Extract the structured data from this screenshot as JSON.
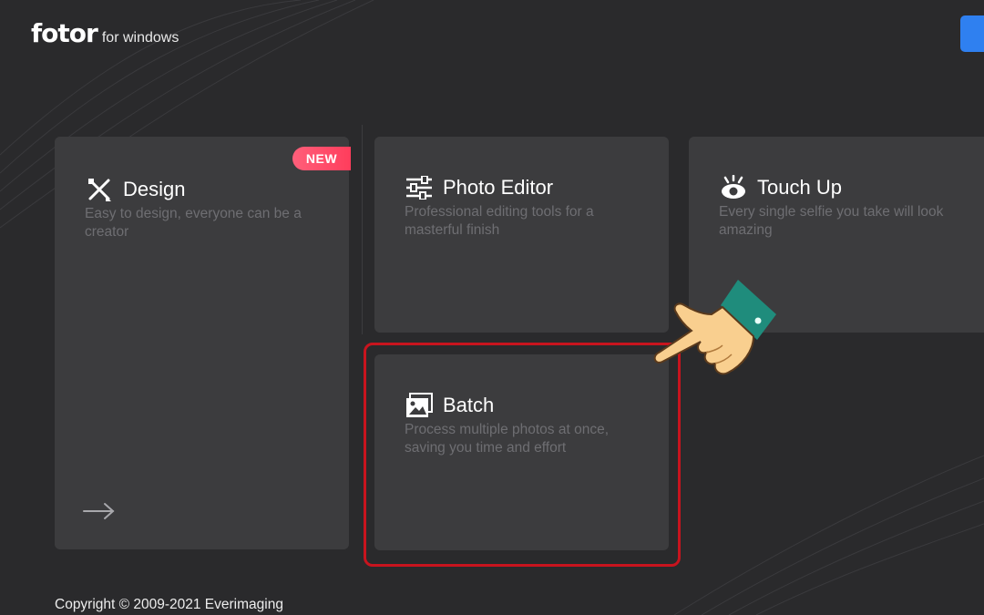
{
  "app": {
    "logo_text": "fotor",
    "logo_suffix": "for windows"
  },
  "cards": {
    "design": {
      "title": "Design",
      "description": "Easy to design, everyone can be a creator",
      "badge": "NEW",
      "icon": "design-pencil-ruler-icon"
    },
    "photo_editor": {
      "title": "Photo Editor",
      "description": "Professional editing tools for a masterful finish",
      "icon": "sliders-icon"
    },
    "touch_up": {
      "title": "Touch Up",
      "description": "Every single selfie you take will look amazing",
      "icon": "eye-icon"
    },
    "batch": {
      "title": "Batch",
      "description": "Process multiple photos at once, saving you time and effort",
      "icon": "images-stack-icon"
    }
  },
  "footer": {
    "copyright": "Copyright © 2009-2021 Everimaging"
  },
  "colors": {
    "background": "#2a2a2c",
    "card": "#3c3c3e",
    "highlight": "#c8141e",
    "badge": "#ff4d6a",
    "accent_button": "#2f80f0"
  }
}
